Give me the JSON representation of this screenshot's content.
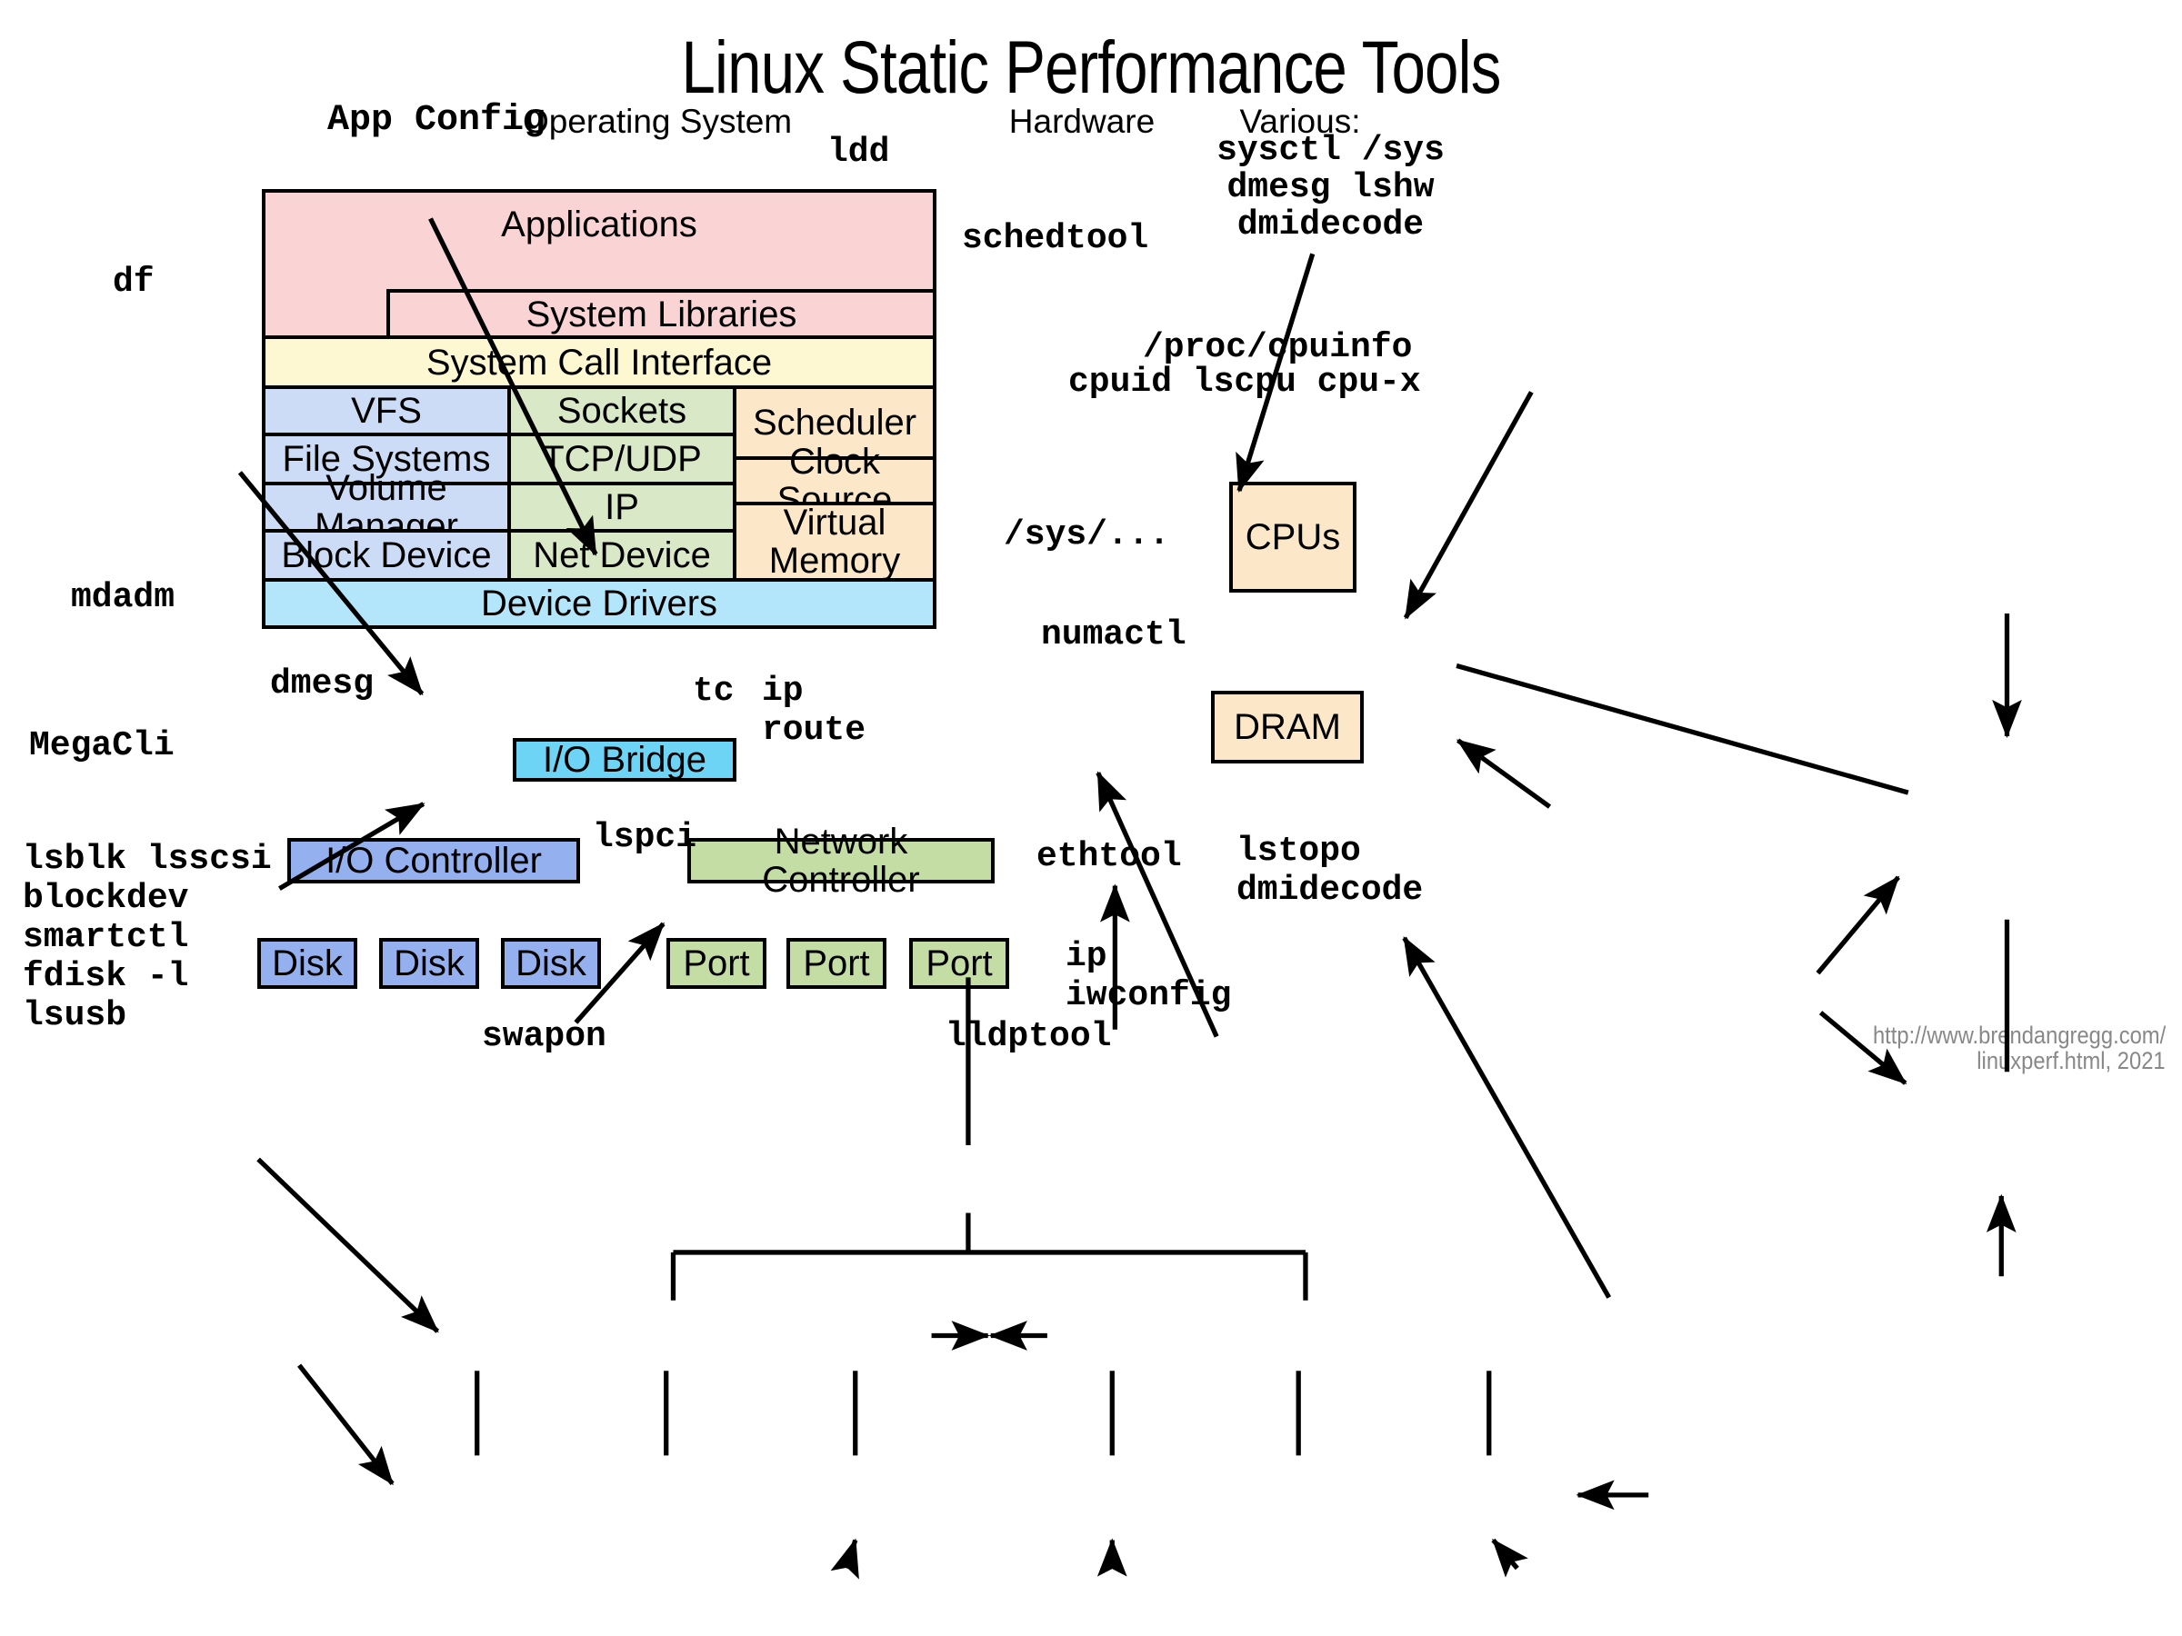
{
  "title": "Linux Static Performance Tools",
  "headers": {
    "app_config": "App Config",
    "operating_system": "Operating System",
    "hardware": "Hardware",
    "various_label": "Various:",
    "various_tools": [
      "sysctl /sys",
      "dmesg lshw",
      "dmidecode"
    ]
  },
  "stack": {
    "applications": "Applications",
    "system_libraries": "System Libraries",
    "system_call_interface": "System Call Interface",
    "device_drivers": "Device Drivers",
    "col_file": [
      "VFS",
      "File Systems",
      "Volume Manager",
      "Block Device"
    ],
    "col_net": [
      "Sockets",
      "TCP/UDP",
      "IP",
      "Net Device"
    ],
    "col_cpu": [
      "Scheduler",
      "Clock Source",
      "Virtual Memory"
    ]
  },
  "hardware": {
    "cpus": "CPUs",
    "dram": "DRAM",
    "io_bridge": "I/O Bridge",
    "io_controller": "I/O Controller",
    "network_controller": "Network Controller",
    "disks": [
      "Disk",
      "Disk",
      "Disk"
    ],
    "ports": [
      "Port",
      "Port",
      "Port"
    ]
  },
  "tools": {
    "ldd": "ldd",
    "schedtool": "schedtool",
    "proc_cpuinfo": "/proc/cpuinfo",
    "cpuid_line": "cpuid lscpu cpu-x",
    "df": "df",
    "mdadm": "mdadm",
    "dmesg": "dmesg",
    "tc": "tc",
    "ip_route": "ip\nroute",
    "sys_dots": "/sys/...",
    "numactl": "numactl",
    "ethtool": "ethtool",
    "lstopo_dmidecode": "lstopo\ndmidecode",
    "megacli": "MegaCli",
    "disk_tools": "lsblk lsscsi\nblockdev\nsmartctl\nfdisk -l\nlsusb",
    "lspci": "lspci",
    "swapon": "swapon",
    "lldptool": "lldptool",
    "ip_iwconfig": "ip\niwconfig"
  },
  "footer": {
    "line1": "http://www.brendangregg.com/",
    "line2": "linuxperf.html, 2021"
  },
  "colors": {
    "pink": "#fad3d4",
    "cream": "#fdf8d2",
    "blue": "#ccdcf7",
    "green": "#d9e8c6",
    "tan": "#fce8c8",
    "cyan": "#b3e6fa",
    "cyan_dark": "#6ed4f5",
    "blue_mid": "#95b0ee",
    "green_mid": "#c3dda4",
    "footer_gray": "#888888"
  }
}
